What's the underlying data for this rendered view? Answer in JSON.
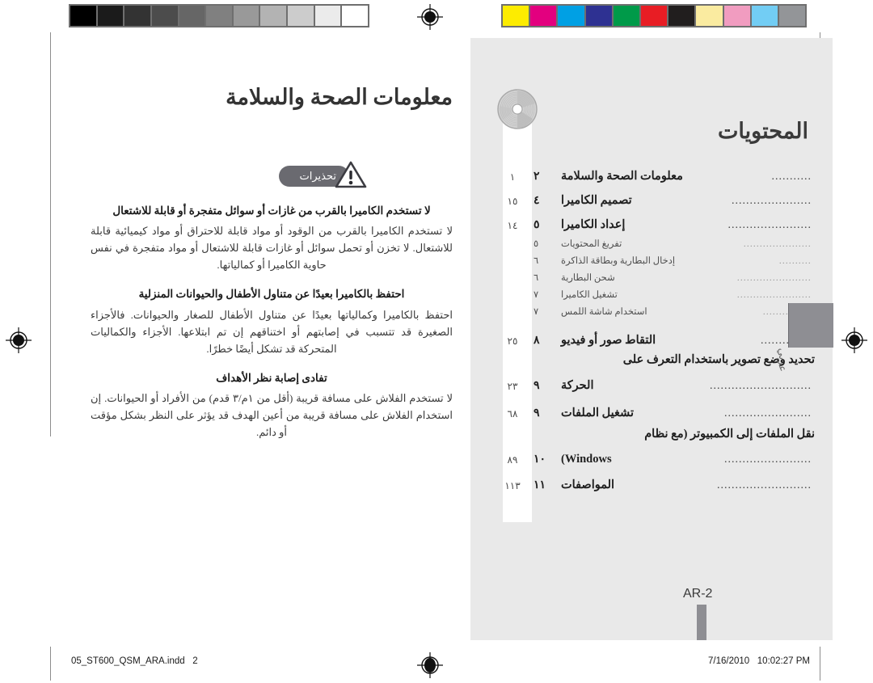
{
  "document": {
    "filename_label": "05_ST600_QSM_ARA.indd   2",
    "timestamp_label": "7/16/2010   10:02:27 PM",
    "page_marker": "AR-2",
    "language_tab": "عربي"
  },
  "calibration": {
    "grayscale_name": "grayscale-calibration-bar",
    "grayscale_swatches": [
      "#000000",
      "#1b1b1b",
      "#333333",
      "#4c4c4c",
      "#666666",
      "#808080",
      "#999999",
      "#b3b3b3",
      "#cccccc",
      "#ebebeb",
      "#ffffff"
    ],
    "color_name": "cmyk-color-calibration-bar",
    "color_swatches": [
      "#fdec00",
      "#e3007f",
      "#00a0e4",
      "#2e3192",
      "#009a49",
      "#e81d24",
      "#211e1e",
      "#faeba0",
      "#f19cc0",
      "#72cdf4",
      "#939598"
    ]
  },
  "left_page": {
    "title": "معلومات الصحة والسلامة",
    "badge_label": "تحذيرات",
    "badge_icon": "warning-triangle-icon",
    "sections": [
      {
        "heading": "لا تستخدم الكاميرا بالقرب من غازات أو سوائل متفجرة أو قابلة للاشتعال",
        "body": "لا تستخدم الكاميرا بالقرب من الوقود أو مواد قابلة للاحتراق أو مواد كيميائية قابلة للاشتعال. لا تخزن أو تحمل سوائل أو غازات قابلة للاشتعال أو مواد متفجرة في نفس حاوية الكاميرا أو كمالياتها."
      },
      {
        "heading": "احتفظ بالكاميرا بعيدًا عن متناول الأطفال والحيوانات المنزلية",
        "body": "احتفظ بالكاميرا وكمالياتها بعيدًا عن متناول الأطفال للصغار والحيوانات. فالأجزاء الصغيرة قد تتسبب في إصابتهم أو اختناقهم إن تم ابتلاعها. الأجزاء والكماليات المتحركة قد تشكل أيضًا خطرًا."
      },
      {
        "heading": "تفادى إصابة نظر الأهداف",
        "body": "لا تستخدم الفلاش على مسافة قريبة (أقل من ١م/٣ قدم) من الأفراد أو الحيوانات. إن استخدام الفلاش على مسافة قريبة من أعين الهدف قد يؤثر على النظر بشكل مؤقت أو دائم."
      }
    ]
  },
  "right_page": {
    "title": "المحتويات",
    "cd_icon": "compact-disc-icon",
    "entries": [
      {
        "level": "main",
        "label": "معلومات الصحة والسلامة",
        "page": "٢",
        "ref": "١"
      },
      {
        "level": "main",
        "label": "تصميم الكاميرا",
        "page": "٤",
        "ref": "١٥"
      },
      {
        "level": "main",
        "label": "إعداد الكاميرا",
        "page": "٥",
        "ref": "١٤"
      },
      {
        "level": "sub",
        "label": "تفريغ المحتويات",
        "page": "٥",
        "ref": ""
      },
      {
        "level": "sub",
        "label": "إدخال البطارية وبطاقة الذاكرة",
        "page": "٦",
        "ref": ""
      },
      {
        "level": "sub",
        "label": "شحن البطارية",
        "page": "٦",
        "ref": ""
      },
      {
        "level": "sub",
        "label": "تشغيل الكاميرا",
        "page": "٧",
        "ref": ""
      },
      {
        "level": "sub",
        "label": "استخدام شاشة اللمس",
        "page": "٧",
        "ref": ""
      },
      {
        "level": "main",
        "label": "التقاط صور أو فيديو",
        "page": "٨",
        "ref": "٢٥"
      },
      {
        "level": "main2",
        "label_line1": "تحديد وضع تصوير باستخدام التعرف على",
        "label_line2": "الحركة",
        "page": "٩",
        "ref": "٢٣"
      },
      {
        "level": "main",
        "label": "تشغيل الملفات",
        "page": "٩",
        "ref": "٦٨"
      },
      {
        "level": "main2",
        "label_line1": "نقل الملفات إلى الكمبيوتر (مع نظام",
        "label_line2": "Windows)",
        "page": "١٠",
        "ref": "٨٩"
      },
      {
        "level": "main",
        "label": "المواصفات",
        "page": "١١",
        "ref": "١١٣"
      }
    ]
  },
  "colors": {
    "page_right_bg": "#e9e9e9",
    "tab_gray": "#8e8e93",
    "badge_gray": "#6a6a70",
    "rule_gray": "#8d8d8d"
  }
}
